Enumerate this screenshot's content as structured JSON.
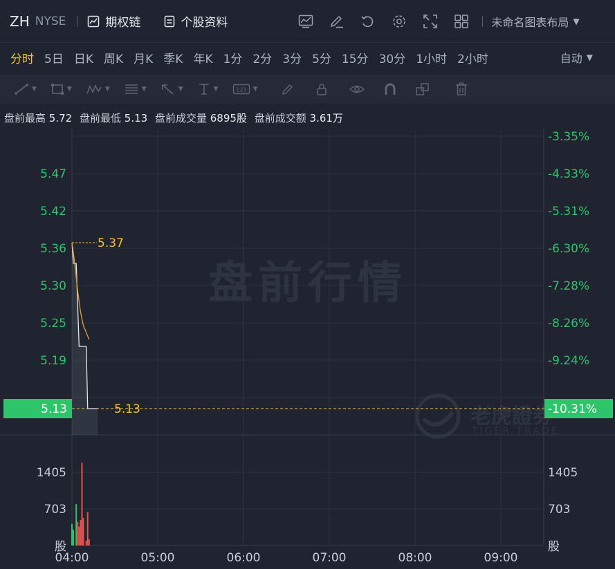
{
  "header": {
    "symbol": "ZH",
    "exchange": "NYSE",
    "options_chain": "期权链",
    "stock_profile": "个股资料",
    "layout_name": "未命名图表布局",
    "icons": [
      "indicator-icon",
      "draw-icon",
      "undo-icon",
      "settings-icon",
      "fullscreen-icon",
      "grid-layout-icon"
    ]
  },
  "timeframes": [
    {
      "label": "分时",
      "active": true
    },
    {
      "label": "5日"
    },
    {
      "label": "日K"
    },
    {
      "label": "周K"
    },
    {
      "label": "月K"
    },
    {
      "label": "季K"
    },
    {
      "label": "年K"
    },
    {
      "label": "1分"
    },
    {
      "label": "2分"
    },
    {
      "label": "3分"
    },
    {
      "label": "5分"
    },
    {
      "label": "15分"
    },
    {
      "label": "30分"
    },
    {
      "label": "1小时"
    },
    {
      "label": "2小时"
    }
  ],
  "auto_label": "自动",
  "info": {
    "high_label": "盘前最高",
    "high": "5.72",
    "low_label": "盘前最低",
    "low": "5.13",
    "vol_label": "盘前成交量",
    "vol": "6895股",
    "amt_label": "盘前成交额",
    "amt": "3.61万"
  },
  "colors": {
    "up": "#2ec46b",
    "down": "#e0534f",
    "price_line": "#e8e8e8",
    "avg_line": "#e0a030",
    "highlight": "#f4c430"
  },
  "chart_data": {
    "type": "line",
    "watermark": "盘前行情",
    "left_ticks": [
      "5.47",
      "5.42",
      "5.36",
      "5.30",
      "5.25",
      "5.19",
      "5.13"
    ],
    "right_ticks": [
      "-3.35%",
      "-4.33%",
      "-5.31%",
      "-6.30%",
      "-7.28%",
      "-8.26%",
      "-9.24%",
      "-10.31%"
    ],
    "current_price": "5.13",
    "current_pct": "-10.31%",
    "open_marker": "5.37",
    "low_marker": "5.13",
    "x_ticks": [
      "04:00",
      "05:00",
      "06:00",
      "07:00",
      "08:00",
      "09:00"
    ],
    "volume_ticks": [
      "1405",
      "703",
      "股"
    ],
    "price_series": [
      {
        "t": 0,
        "p": 5.37
      },
      {
        "t": 1,
        "p": 5.34
      },
      {
        "t": 3,
        "p": 5.34
      },
      {
        "t": 5,
        "p": 5.22
      },
      {
        "t": 10,
        "p": 5.22
      },
      {
        "t": 11,
        "p": 5.13
      },
      {
        "t": 13,
        "p": 5.13
      },
      {
        "t": 18,
        "p": 5.13
      }
    ],
    "avg_series": [
      {
        "t": 0,
        "p": 5.37
      },
      {
        "t": 2,
        "p": 5.34
      },
      {
        "t": 4,
        "p": 5.3
      },
      {
        "t": 6,
        "p": 5.27
      },
      {
        "t": 8,
        "p": 5.25
      },
      {
        "t": 10,
        "p": 5.24
      },
      {
        "t": 12,
        "p": 5.23
      }
    ],
    "volume": [
      {
        "t": 0,
        "v": 550,
        "dir": "up"
      },
      {
        "t": 1,
        "v": 400,
        "dir": "up"
      },
      {
        "t": 3,
        "v": 1050,
        "dir": "up"
      },
      {
        "t": 4,
        "v": 600,
        "dir": "down"
      },
      {
        "t": 5,
        "v": 480,
        "dir": "down"
      },
      {
        "t": 6,
        "v": 650,
        "dir": "down"
      },
      {
        "t": 7,
        "v": 2100,
        "dir": "down"
      },
      {
        "t": 8,
        "v": 700,
        "dir": "down"
      },
      {
        "t": 10,
        "v": 120,
        "dir": "down"
      },
      {
        "t": 11,
        "v": 850,
        "dir": "down"
      },
      {
        "t": 12,
        "v": 160,
        "dir": "down"
      }
    ],
    "y_price_range": [
      5.092,
      5.535
    ],
    "volume_max": 2810,
    "x_range_minutes": [
      0,
      330
    ]
  }
}
